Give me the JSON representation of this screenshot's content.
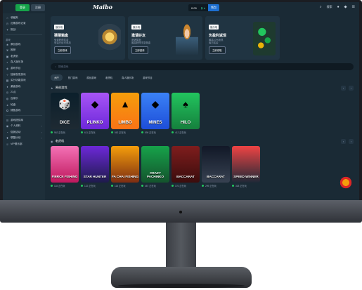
{
  "header": {
    "login_label": "登录",
    "register_label": "注册",
    "logo": "Maibo",
    "balance": "0.00",
    "currency": "₿ ▾",
    "wallet_label": "钱包",
    "search_label": "搜索"
  },
  "sidebar": {
    "top_items": [
      {
        "icon": "home-icon",
        "label": "收藏夹"
      },
      {
        "icon": "clock-icon",
        "label": "近期游戏记录"
      },
      {
        "icon": "gift-icon",
        "label": "挑战"
      }
    ],
    "casino_section": "游戏",
    "items": [
      {
        "label": "原创游戏"
      },
      {
        "label": "推荐"
      },
      {
        "label": "老虎机"
      },
      {
        "label": "真人娱乐场"
      },
      {
        "label": "游戏节目"
      },
      {
        "label": "独家首发游戏"
      },
      {
        "label": "买分功能游戏"
      },
      {
        "label": "桌面游戏"
      },
      {
        "label": "21点"
      },
      {
        "label": "百家乐"
      },
      {
        "label": "轮盘"
      },
      {
        "label": "捕鱼游戏"
      }
    ],
    "bottom_items": [
      {
        "label": "游戏提供商"
      },
      {
        "label": "个人资料"
      },
      {
        "label": "促销活动"
      },
      {
        "label": "联盟计划"
      },
      {
        "label": "VIP俱乐部"
      }
    ]
  },
  "promos": [
    {
      "tag": "娱乐场",
      "title": "猜猜箱盒",
      "sub": "免费获得奖金\n电话已经可参加",
      "cta": "立即游戏"
    },
    {
      "tag": "娱乐场",
      "title": "邀请好友",
      "sub": "邀请奖励\n最高获得丰厚佣金",
      "cta": "立即邀请"
    },
    {
      "tag": "娱乐场",
      "title": "负盈利返现",
      "sub": "最高10%返现\n每日奖金",
      "cta": "立即领取"
    }
  ],
  "search": {
    "placeholder": "搜索游戏"
  },
  "tabs": [
    "大厅",
    "热门游戏",
    "原创游戏",
    "老虎机",
    "真人娱乐场",
    "游戏节目"
  ],
  "originals": {
    "title": "原创游戏",
    "games": [
      {
        "name": "DICE",
        "glyph": "🎲",
        "players": "962 正在玩"
      },
      {
        "name": "PLINKO",
        "glyph": "◆",
        "players": "611 正在玩"
      },
      {
        "name": "LIMBO",
        "glyph": "▲",
        "players": "562 正在玩"
      },
      {
        "name": "MINES",
        "glyph": "◆",
        "players": "590 正在玩"
      },
      {
        "name": "HILO",
        "glyph": "♠",
        "players": "412 正在玩"
      }
    ]
  },
  "slots": {
    "title": "老虎机",
    "games": [
      {
        "name": "FIERCE FISHING",
        "players": "118 正在玩"
      },
      {
        "name": "STAR HUNTER",
        "players": "122 正在玩"
      },
      {
        "name": "FA CHAI FISHING",
        "players": "118 正在玩"
      },
      {
        "name": "CRAZY PACHINKO",
        "players": "457 正在玩"
      },
      {
        "name": "BACCARAT",
        "players": "176 正在玩"
      },
      {
        "name": "BACCARAT",
        "players": "299 正在玩"
      },
      {
        "name": "SPEED WINNER",
        "players": "318 正在玩"
      }
    ]
  }
}
